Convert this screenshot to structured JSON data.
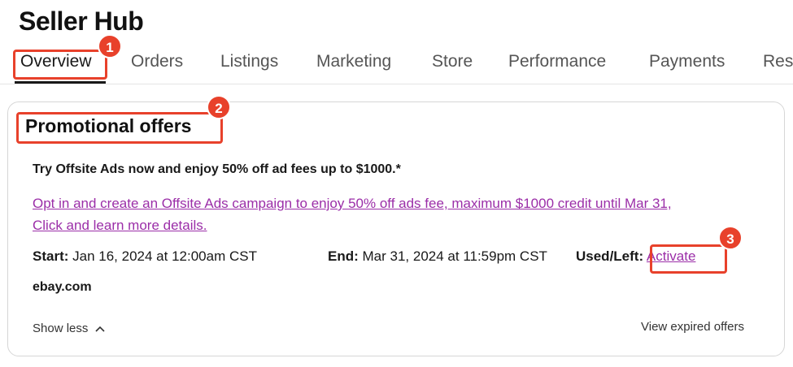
{
  "header": {
    "title": "Seller Hub"
  },
  "tabs": [
    {
      "label": "Overview"
    },
    {
      "label": "Orders"
    },
    {
      "label": "Listings"
    },
    {
      "label": "Marketing"
    },
    {
      "label": "Store"
    },
    {
      "label": "Performance"
    },
    {
      "label": "Payments"
    },
    {
      "label": "Res"
    }
  ],
  "promo_card": {
    "title": "Promotional offers",
    "headline": "Try Offsite Ads now and enjoy 50% off ad fees up to $1000.*",
    "link_line1": "Opt in and create an Offsite Ads campaign to enjoy 50% off ads fee, maximum $1000 credit until Mar 31,",
    "link_line2": "Click and learn more details.",
    "start_label": "Start:",
    "start_value": "Jan 16, 2024 at 12:00am CST",
    "end_label": "End:",
    "end_value": "Mar 31, 2024 at 11:59pm CST",
    "used_label": "Used/Left:",
    "activate_label": "Activate",
    "seller": "ebay.com",
    "show_less_label": "Show less",
    "view_expired_label": "View expired offers"
  },
  "annotations": {
    "badge_1": "1",
    "badge_2": "2",
    "badge_3": "3"
  },
  "colors": {
    "link": "#9b2ea8",
    "annotation": "#e8412b"
  },
  "icons": [
    "chevron-up-icon"
  ]
}
